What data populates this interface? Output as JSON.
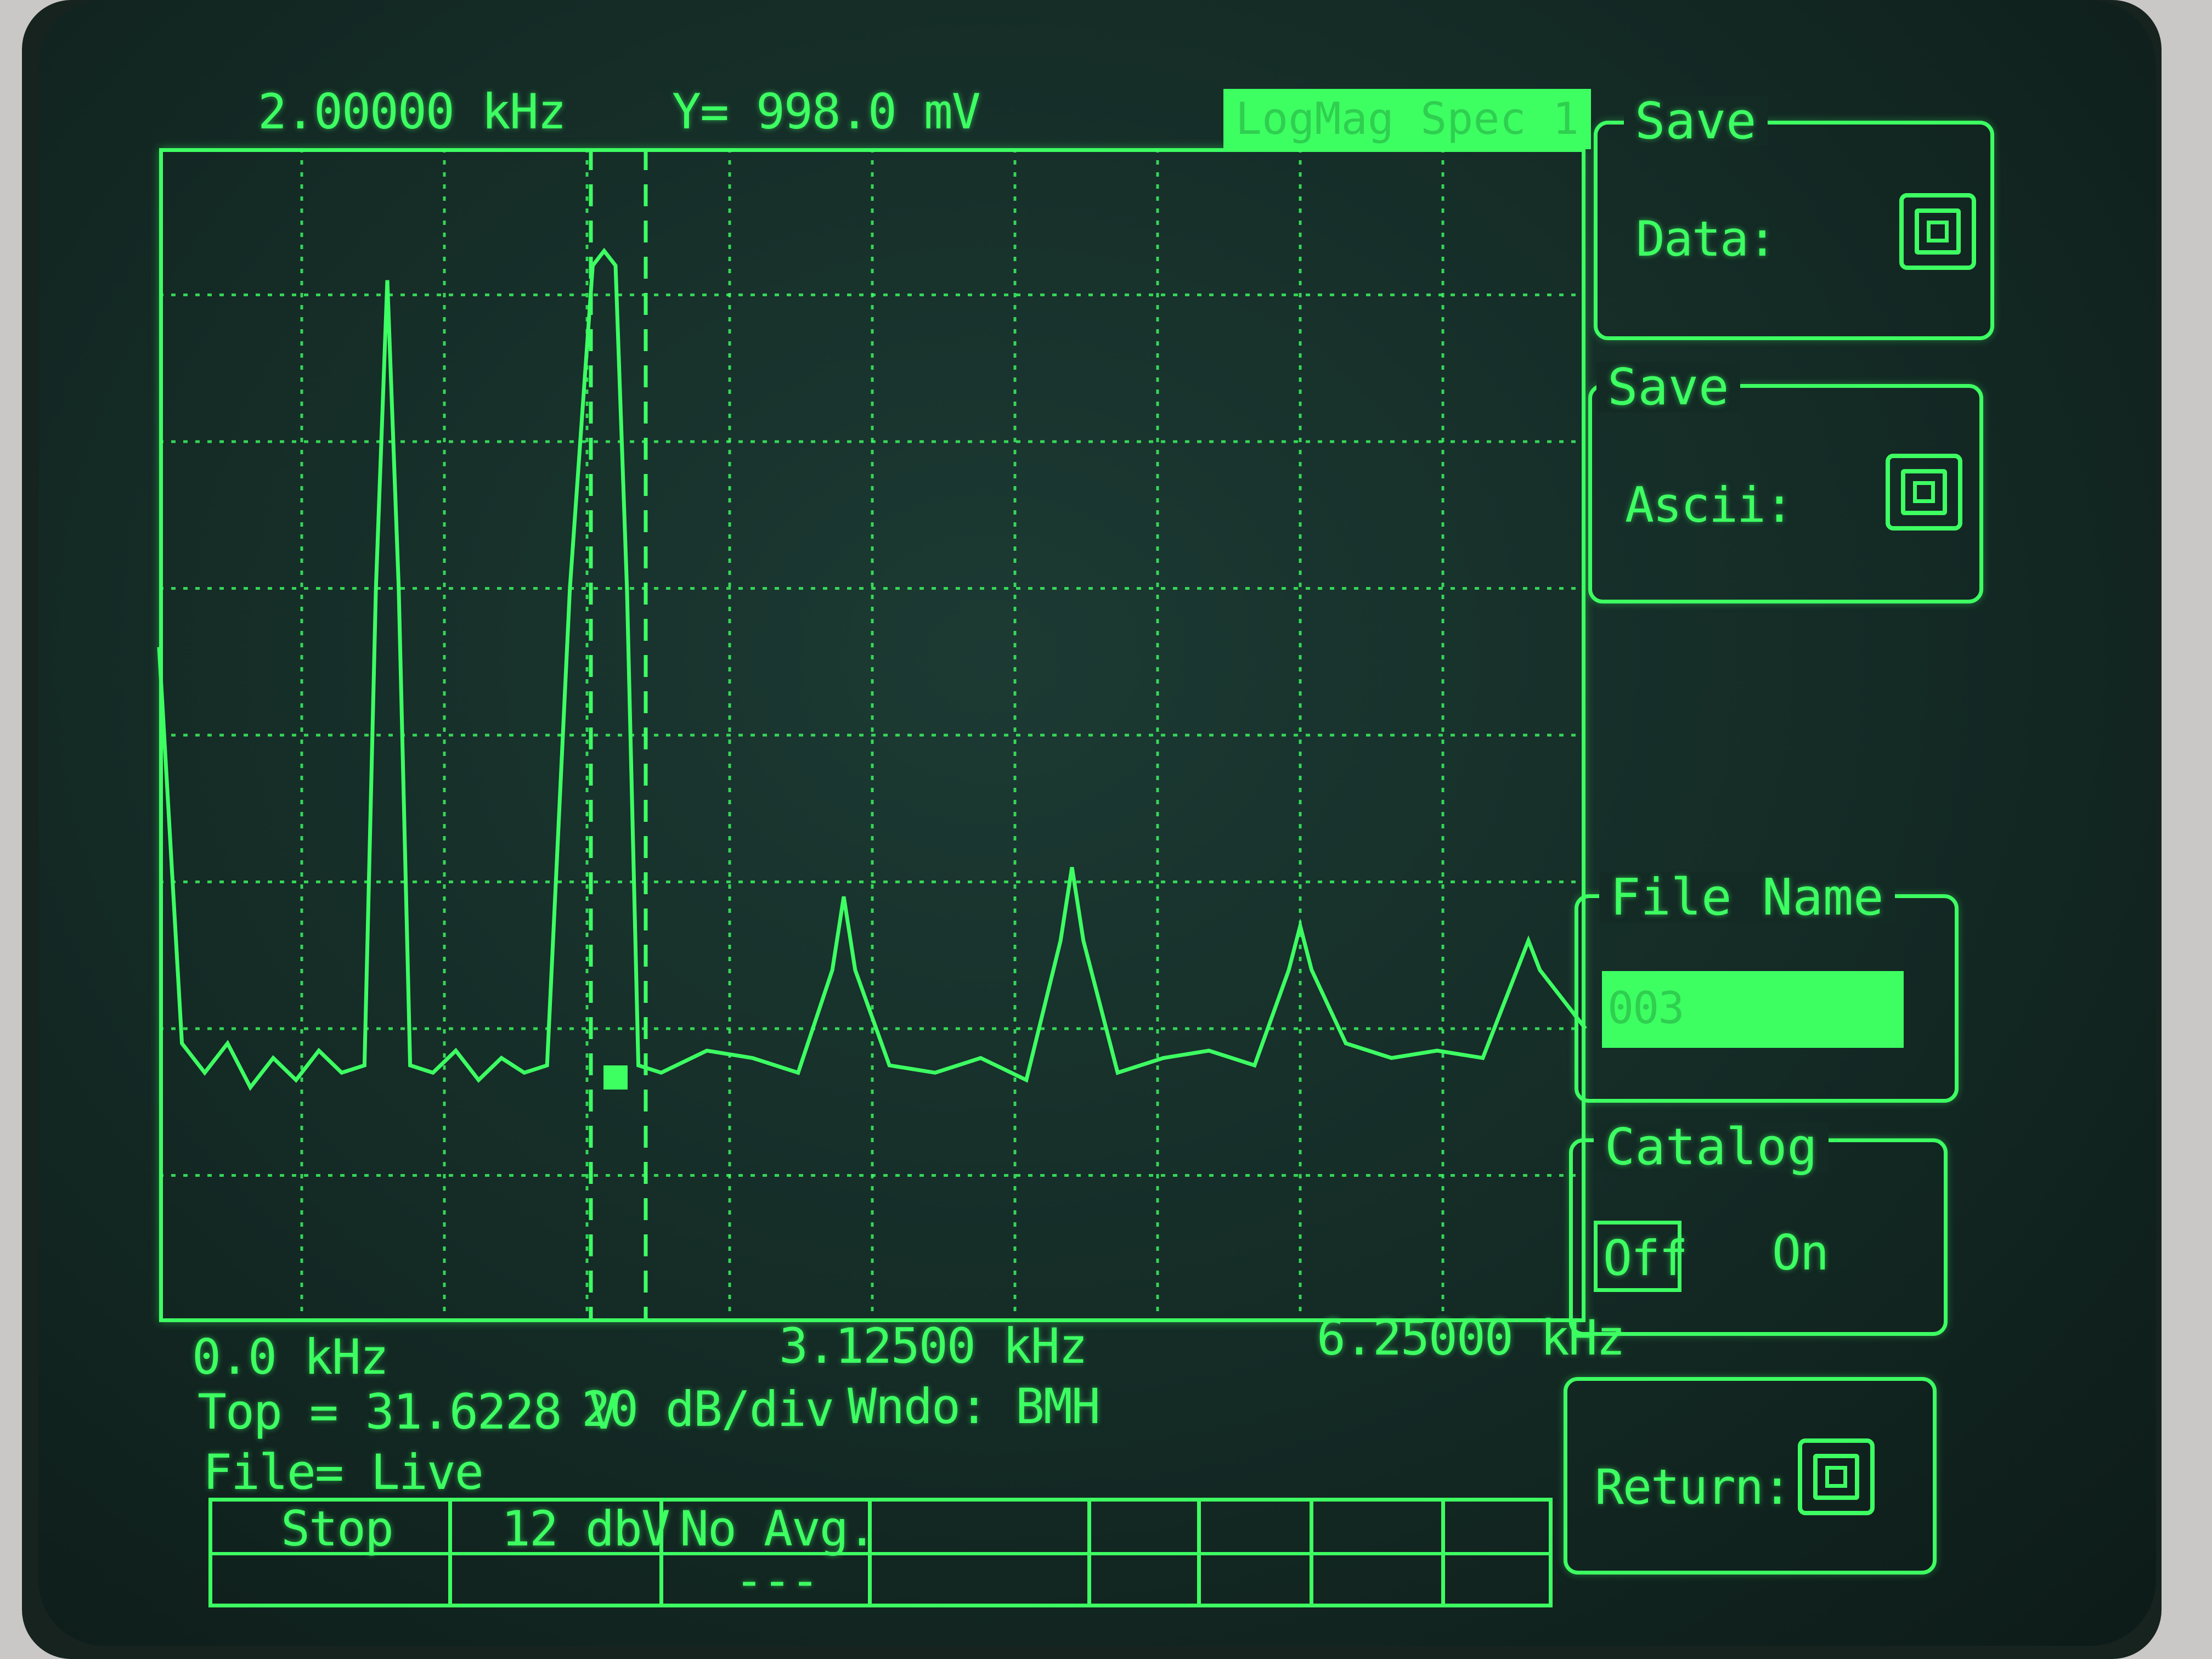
{
  "header": {
    "marker_freq": "2.00000 kHz",
    "marker_y": "Y= 998.0 mV",
    "trace_mode": "LogMag Spec  1"
  },
  "axis": {
    "start": "0.0 kHz",
    "center": "3.12500 kHz",
    "stop": "6.25000 kHz"
  },
  "status": {
    "top_ref": "Top = 31.6228 V",
    "scale": "20 dB/div",
    "window": "Wndo: BMH",
    "file": "File= Live"
  },
  "softkeys": [
    {
      "label": "Stop",
      "sub": ""
    },
    {
      "label": "12 dbV",
      "sub": ""
    },
    {
      "label": "No Avg.",
      "sub": "---"
    },
    {
      "label": "",
      "sub": ""
    },
    {
      "label": "",
      "sub": ""
    },
    {
      "label": "",
      "sub": ""
    },
    {
      "label": "",
      "sub": ""
    },
    {
      "label": "",
      "sub": ""
    }
  ],
  "menu": {
    "save_data_title": "Save",
    "save_data_label": "Data:",
    "save_ascii_title": "Save",
    "save_ascii_label": "Ascii:",
    "file_name_title": "File Name",
    "file_name_value": "003",
    "catalog_title": "Catalog",
    "catalog_off": "Off",
    "catalog_on": "On",
    "return_label": "Return:"
  },
  "chart_data": {
    "type": "line",
    "title": "",
    "xlabel": "kHz",
    "ylabel": "dB",
    "xlim": [
      0,
      6.25
    ],
    "x_ticks": [
      "0.0 kHz",
      "3.12500 kHz",
      "6.25000 kHz"
    ],
    "grid": true,
    "scale_db_per_div": 20,
    "divisions": 8,
    "ylim_db_rel_top": [
      -160,
      0
    ],
    "marker_x_khz": 2.0,
    "series": [
      {
        "x": [
          0.0,
          0.1,
          0.2,
          0.3,
          0.4,
          0.5,
          0.6,
          0.7,
          0.8,
          0.9,
          0.95,
          1.0,
          1.05,
          1.1,
          1.2,
          1.3,
          1.4,
          1.5,
          1.6,
          1.7,
          1.8,
          1.9,
          1.95,
          2.0,
          2.05,
          2.1,
          2.2,
          2.4,
          2.6,
          2.8,
          2.95,
          3.0,
          3.05,
          3.2,
          3.4,
          3.6,
          3.8,
          3.95,
          4.0,
          4.05,
          4.2,
          4.4,
          4.6,
          4.8,
          4.95,
          5.0,
          5.05,
          5.2,
          5.4,
          5.6,
          5.8,
          5.95,
          6.0,
          6.05,
          6.25
        ],
        "y": [
          -68,
          -122,
          -126,
          -122,
          -128,
          -124,
          -127,
          -123,
          -126,
          -125,
          -60,
          -18,
          -60,
          -125,
          -126,
          -123,
          -127,
          -124,
          -126,
          -125,
          -60,
          -16,
          -14,
          -16,
          -60,
          -125,
          -126,
          -123,
          -124,
          -126,
          -112,
          -102,
          -112,
          -125,
          -126,
          -124,
          -127,
          -108,
          -98,
          -108,
          -126,
          -124,
          -123,
          -125,
          -112,
          -106,
          -112,
          -122,
          -124,
          -123,
          -124,
          -112,
          -108,
          -112,
          -120
        ]
      }
    ]
  }
}
